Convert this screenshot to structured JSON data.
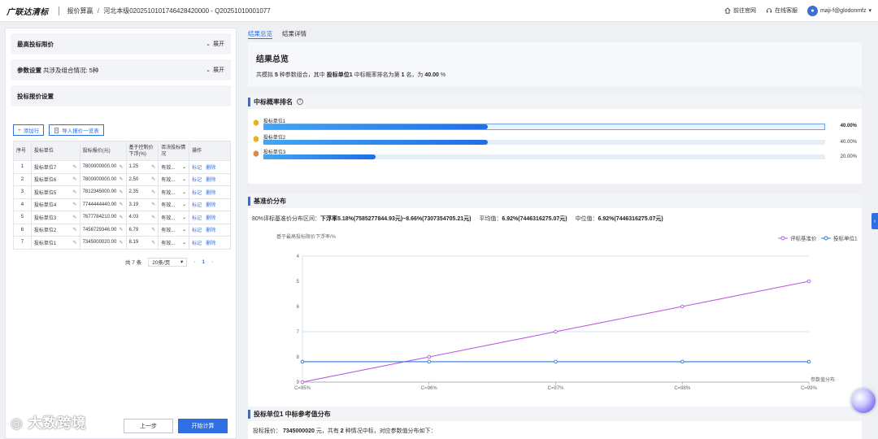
{
  "topbar": {
    "brand": "广联达清标",
    "crumb1": "报价算赢",
    "crumb_sep": "/",
    "crumb2": "河北本级0202510101746428420000 - Q20251010001077",
    "visit_site": "前往官网",
    "support": "在线客服",
    "user": "maji-f@glodonmfz"
  },
  "left": {
    "acc_highest": "最高投标限价",
    "acc_params": "参数设置",
    "acc_params_sub": "共涉及组合情况: 5种",
    "expand": "展开",
    "section_bid": "投标报价设置",
    "btn_add": "添加行",
    "btn_import": "导入报价一览表",
    "table_headers": [
      "序号",
      "投标单位",
      "投标报价(元)",
      "基于控制价下浮(%)",
      "否决投标情况",
      "操作"
    ],
    "rows": [
      {
        "no": "1",
        "name": "投标单位7",
        "price": "7800000000.00",
        "rate": "1.25",
        "veto": "有效..."
      },
      {
        "no": "2",
        "name": "投标单位6",
        "price": "7800000000.00",
        "rate": "2.50",
        "veto": "有效..."
      },
      {
        "no": "3",
        "name": "投标单位5",
        "price": "7812345000.00",
        "rate": "2.35",
        "veto": "有效..."
      },
      {
        "no": "4",
        "name": "投标单位4",
        "price": "7744444440.00",
        "rate": "3.19",
        "veto": "有效..."
      },
      {
        "no": "5",
        "name": "投标单位3",
        "price": "7677784210.00",
        "rate": "4.03",
        "veto": "有效..."
      },
      {
        "no": "6",
        "name": "投标单位2",
        "price": "7456729346.00",
        "rate": "6.79",
        "veto": "有效..."
      },
      {
        "no": "7",
        "name": "投标单位1",
        "price": "7345000020.00",
        "rate": "8.19",
        "veto": "有效..."
      }
    ],
    "op_mark": "标记",
    "op_delete": "删除",
    "pager_total": "共 7 条",
    "pager_size": "20条/页",
    "pager_current": "1",
    "btn_prev": "上一步",
    "btn_start": "开始计算",
    "watermark": "大数跨境"
  },
  "right": {
    "tab_summary": "结果总览",
    "tab_detail": "结果详情",
    "ov_title": "结果总览",
    "ov_p1": "共模拟",
    "ov_count": "5",
    "ov_p2": "种参数组合，其中",
    "ov_unit": "投标单位1",
    "ov_p3": "中标概率排名为第",
    "ov_rank": "1",
    "ov_p4": "名，为",
    "ov_pct": "40.00",
    "ov_p5": "%",
    "rank_title": "中标概率排名",
    "rank": [
      {
        "name": "投标单位1",
        "value": 40.0,
        "label": "40.00%",
        "highlight": true,
        "medal": "#e8b21f"
      },
      {
        "name": "投标单位2",
        "value": 40.0,
        "label": "40.00%",
        "highlight": false,
        "medal": "#e8b21f"
      },
      {
        "name": "投标单位3",
        "value": 20.0,
        "label": "20.00%",
        "highlight": false,
        "medal": "#d9874a"
      }
    ],
    "dist_title": "基准价分布",
    "dist_l1": "80%评标基准价分布区间：",
    "dist_v1": "下浮率5.18%(7585277844.93元)~8.66%(7307354705.21元)",
    "dist_l2": "平均值：",
    "dist_v2": "6.92%(7446316275.07元)",
    "dist_l3": "中位值：",
    "dist_v3": "6.92%(7446316275.07元)",
    "bid_title": "投标单位1 中标参考值分布",
    "bid_l1": "投标报价：",
    "bid_price": "7345000020",
    "bid_l2": "元，共有",
    "bid_count": "2",
    "bid_l3": "种情况中标，对应参数值分布如下："
  },
  "chart_data": {
    "type": "line",
    "ylabel": "基于最高投标限价下浮率/%",
    "xlabel": "参数值分布",
    "x": [
      "C=95%",
      "C=96%",
      "C=97%",
      "C=98%",
      "C=99%"
    ],
    "yticks": [
      4,
      5,
      6,
      7,
      8,
      9
    ],
    "ylim": [
      4,
      9
    ],
    "y_inverted": true,
    "legend_position": "top-right",
    "series": [
      {
        "name": "评标基准价",
        "color": "#b65ce0",
        "values": [
          9.0,
          8.0,
          7.0,
          6.0,
          5.0
        ]
      },
      {
        "name": "投标单位1",
        "color": "#2f7ad8",
        "values": [
          8.19,
          8.19,
          8.19,
          8.19,
          8.19
        ]
      }
    ]
  }
}
